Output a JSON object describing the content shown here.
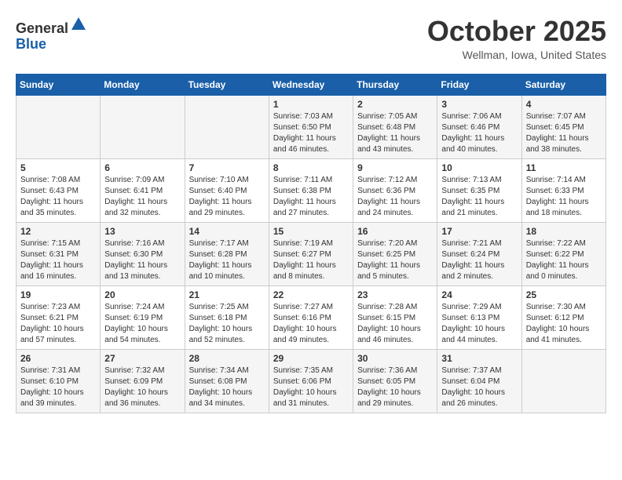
{
  "header": {
    "logo_general": "General",
    "logo_blue": "Blue",
    "month_title": "October 2025",
    "location": "Wellman, Iowa, United States"
  },
  "weekdays": [
    "Sunday",
    "Monday",
    "Tuesday",
    "Wednesday",
    "Thursday",
    "Friday",
    "Saturday"
  ],
  "weeks": [
    [
      {
        "day": "",
        "info": ""
      },
      {
        "day": "",
        "info": ""
      },
      {
        "day": "",
        "info": ""
      },
      {
        "day": "1",
        "info": "Sunrise: 7:03 AM\nSunset: 6:50 PM\nDaylight: 11 hours and 46 minutes."
      },
      {
        "day": "2",
        "info": "Sunrise: 7:05 AM\nSunset: 6:48 PM\nDaylight: 11 hours and 43 minutes."
      },
      {
        "day": "3",
        "info": "Sunrise: 7:06 AM\nSunset: 6:46 PM\nDaylight: 11 hours and 40 minutes."
      },
      {
        "day": "4",
        "info": "Sunrise: 7:07 AM\nSunset: 6:45 PM\nDaylight: 11 hours and 38 minutes."
      }
    ],
    [
      {
        "day": "5",
        "info": "Sunrise: 7:08 AM\nSunset: 6:43 PM\nDaylight: 11 hours and 35 minutes."
      },
      {
        "day": "6",
        "info": "Sunrise: 7:09 AM\nSunset: 6:41 PM\nDaylight: 11 hours and 32 minutes."
      },
      {
        "day": "7",
        "info": "Sunrise: 7:10 AM\nSunset: 6:40 PM\nDaylight: 11 hours and 29 minutes."
      },
      {
        "day": "8",
        "info": "Sunrise: 7:11 AM\nSunset: 6:38 PM\nDaylight: 11 hours and 27 minutes."
      },
      {
        "day": "9",
        "info": "Sunrise: 7:12 AM\nSunset: 6:36 PM\nDaylight: 11 hours and 24 minutes."
      },
      {
        "day": "10",
        "info": "Sunrise: 7:13 AM\nSunset: 6:35 PM\nDaylight: 11 hours and 21 minutes."
      },
      {
        "day": "11",
        "info": "Sunrise: 7:14 AM\nSunset: 6:33 PM\nDaylight: 11 hours and 18 minutes."
      }
    ],
    [
      {
        "day": "12",
        "info": "Sunrise: 7:15 AM\nSunset: 6:31 PM\nDaylight: 11 hours and 16 minutes."
      },
      {
        "day": "13",
        "info": "Sunrise: 7:16 AM\nSunset: 6:30 PM\nDaylight: 11 hours and 13 minutes."
      },
      {
        "day": "14",
        "info": "Sunrise: 7:17 AM\nSunset: 6:28 PM\nDaylight: 11 hours and 10 minutes."
      },
      {
        "day": "15",
        "info": "Sunrise: 7:19 AM\nSunset: 6:27 PM\nDaylight: 11 hours and 8 minutes."
      },
      {
        "day": "16",
        "info": "Sunrise: 7:20 AM\nSunset: 6:25 PM\nDaylight: 11 hours and 5 minutes."
      },
      {
        "day": "17",
        "info": "Sunrise: 7:21 AM\nSunset: 6:24 PM\nDaylight: 11 hours and 2 minutes."
      },
      {
        "day": "18",
        "info": "Sunrise: 7:22 AM\nSunset: 6:22 PM\nDaylight: 11 hours and 0 minutes."
      }
    ],
    [
      {
        "day": "19",
        "info": "Sunrise: 7:23 AM\nSunset: 6:21 PM\nDaylight: 10 hours and 57 minutes."
      },
      {
        "day": "20",
        "info": "Sunrise: 7:24 AM\nSunset: 6:19 PM\nDaylight: 10 hours and 54 minutes."
      },
      {
        "day": "21",
        "info": "Sunrise: 7:25 AM\nSunset: 6:18 PM\nDaylight: 10 hours and 52 minutes."
      },
      {
        "day": "22",
        "info": "Sunrise: 7:27 AM\nSunset: 6:16 PM\nDaylight: 10 hours and 49 minutes."
      },
      {
        "day": "23",
        "info": "Sunrise: 7:28 AM\nSunset: 6:15 PM\nDaylight: 10 hours and 46 minutes."
      },
      {
        "day": "24",
        "info": "Sunrise: 7:29 AM\nSunset: 6:13 PM\nDaylight: 10 hours and 44 minutes."
      },
      {
        "day": "25",
        "info": "Sunrise: 7:30 AM\nSunset: 6:12 PM\nDaylight: 10 hours and 41 minutes."
      }
    ],
    [
      {
        "day": "26",
        "info": "Sunrise: 7:31 AM\nSunset: 6:10 PM\nDaylight: 10 hours and 39 minutes."
      },
      {
        "day": "27",
        "info": "Sunrise: 7:32 AM\nSunset: 6:09 PM\nDaylight: 10 hours and 36 minutes."
      },
      {
        "day": "28",
        "info": "Sunrise: 7:34 AM\nSunset: 6:08 PM\nDaylight: 10 hours and 34 minutes."
      },
      {
        "day": "29",
        "info": "Sunrise: 7:35 AM\nSunset: 6:06 PM\nDaylight: 10 hours and 31 minutes."
      },
      {
        "day": "30",
        "info": "Sunrise: 7:36 AM\nSunset: 6:05 PM\nDaylight: 10 hours and 29 minutes."
      },
      {
        "day": "31",
        "info": "Sunrise: 7:37 AM\nSunset: 6:04 PM\nDaylight: 10 hours and 26 minutes."
      },
      {
        "day": "",
        "info": ""
      }
    ]
  ]
}
